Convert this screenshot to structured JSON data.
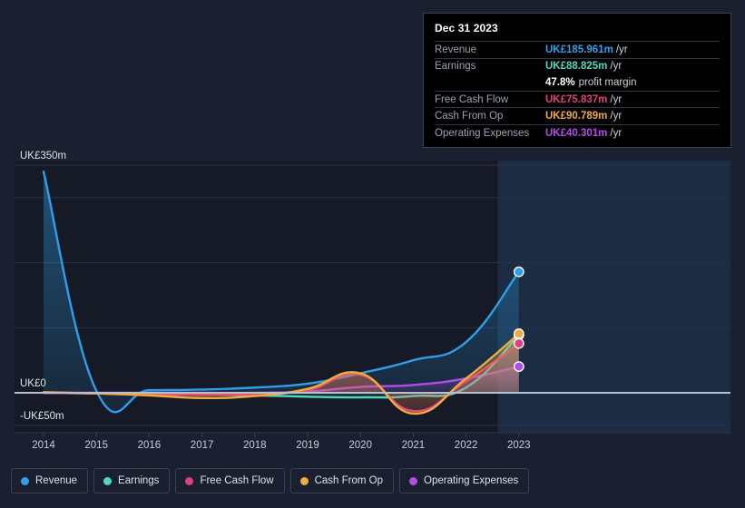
{
  "tooltip": {
    "date": "Dec 31 2023",
    "rows": [
      {
        "label": "Revenue",
        "value": "UK£185.961m",
        "unit": "/yr",
        "color": "#2e9fe8"
      },
      {
        "label": "Earnings",
        "value": "UK£88.825m",
        "unit": "/yr",
        "color": "#4fd8c0"
      },
      {
        "label": "",
        "value": "47.8%",
        "unit": "profit margin",
        "color": "#ffffff"
      },
      {
        "label": "Free Cash Flow",
        "value": "UK£75.837m",
        "unit": "/yr",
        "color": "#e0407e"
      },
      {
        "label": "Cash From Op",
        "value": "UK£90.789m",
        "unit": "/yr",
        "color": "#f0ab3c"
      },
      {
        "label": "Operating Expenses",
        "value": "UK£40.301m",
        "unit": "/yr",
        "color": "#b44ce8"
      }
    ]
  },
  "legend": {
    "items": [
      {
        "label": "Revenue",
        "color": "#2e9fe8"
      },
      {
        "label": "Earnings",
        "color": "#4fd8c0"
      },
      {
        "label": "Free Cash Flow",
        "color": "#e0407e"
      },
      {
        "label": "Cash From Op",
        "color": "#f0ab3c"
      },
      {
        "label": "Operating Expenses",
        "color": "#b44ce8"
      }
    ]
  },
  "chart_data": {
    "type": "line",
    "title": "",
    "xlabel": "",
    "ylabel": "",
    "currency": "UK£",
    "unit": "m",
    "grid": true,
    "legend_position": "bottom",
    "x": [
      2014,
      2015,
      2016,
      2017,
      2018,
      2019,
      2020,
      2021,
      2022,
      2023
    ],
    "xtick_labels": [
      "2014",
      "2015",
      "2016",
      "2017",
      "2018",
      "2019",
      "2020",
      "2021",
      "2022",
      "2023"
    ],
    "ylim": [
      -50,
      350
    ],
    "ytick_values": [
      350,
      0,
      -50
    ],
    "ytick_labels": [
      "UK£350m",
      "UK£0",
      "-UK£50m"
    ],
    "gridline_values": [
      350,
      300,
      200,
      100,
      0,
      -50
    ],
    "highlight_band": {
      "from": 2022.6,
      "to": 2023.0,
      "label": ""
    },
    "series": [
      {
        "name": "Revenue",
        "color": "#2e9fe8",
        "end_value": 185.961,
        "end_marker": true,
        "values": [
          340,
          3,
          4,
          5,
          8,
          14,
          30,
          50,
          78,
          185.961
        ]
      },
      {
        "name": "Earnings",
        "color": "#4fd8c0",
        "end_value": 88.825,
        "end_marker": true,
        "values": [
          0,
          -1,
          -2,
          -3,
          -4,
          -6,
          -7,
          -5,
          8,
          88.825
        ]
      },
      {
        "name": "Free Cash Flow",
        "color": "#e0407e",
        "end_value": 75.837,
        "end_marker": true,
        "values": [
          0,
          -1,
          -3,
          -3,
          -2,
          4,
          28,
          -28,
          18,
          75.837
        ]
      },
      {
        "name": "Cash From Op",
        "color": "#f0ab3c",
        "end_value": 90.789,
        "end_marker": true,
        "values": [
          1,
          -1,
          -4,
          -8,
          -5,
          6,
          30,
          -32,
          22,
          90.789
        ]
      },
      {
        "name": "Operating Expenses",
        "color": "#b44ce8",
        "end_value": 40.301,
        "end_marker": true,
        "values": [
          0,
          0,
          0,
          0,
          0,
          2,
          9,
          12,
          22,
          40.301
        ]
      }
    ]
  }
}
